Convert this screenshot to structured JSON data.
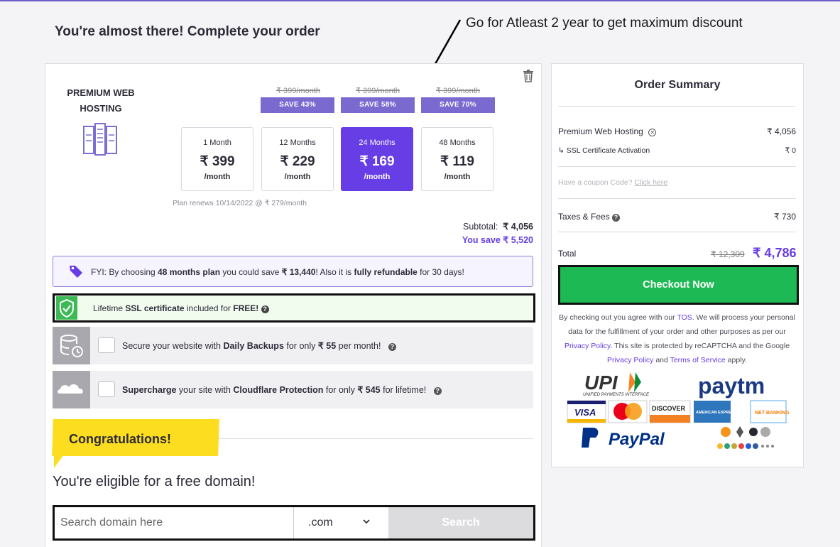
{
  "header": {
    "title": "You're almost there! Complete your order",
    "annotation": "Go for Atleast 2 year to get maximum discount"
  },
  "product": {
    "name": "PREMIUM WEB HOSTING",
    "icon": "server-icon"
  },
  "plans": [
    {
      "duration": "1 Month",
      "price": "₹ 399",
      "per": "/month",
      "old_price": "",
      "badge": "",
      "selected": false
    },
    {
      "duration": "12 Months",
      "price": "₹ 229",
      "per": "/month",
      "old_price": "₹ 399/month",
      "badge": "SAVE 43%",
      "selected": false
    },
    {
      "duration": "24 Months",
      "price": "₹ 169",
      "per": "/month",
      "old_price": "₹ 399/month",
      "badge": "SAVE 58%",
      "selected": true
    },
    {
      "duration": "48 Months",
      "price": "₹ 119",
      "per": "/month",
      "old_price": "₹ 399/month",
      "badge": "SAVE 70%",
      "selected": false
    }
  ],
  "renews": "Plan renews 10/14/2022 @ ₹ 279/month",
  "subtotal": {
    "label": "Subtotal:",
    "value": "₹ 4,056"
  },
  "you_save": "You save ₹ 5,520",
  "fyi": {
    "prefix": "FYI: By choosing ",
    "plan": "48 months plan",
    "mid": " you could save ",
    "amount": "₹ 13,440",
    "mid2": "! Also it is ",
    "refund": "fully refundable",
    "suffix": " for 30 days!"
  },
  "ssl": {
    "prefix": "Lifetime ",
    "bold": "SSL certificate",
    "mid": " included for ",
    "free": "FREE!"
  },
  "addons": {
    "backups": {
      "prefix": "Secure your website with ",
      "bold": "Daily Backups",
      "mid": " for only ",
      "price": "₹ 55",
      "suffix": " per month!"
    },
    "cloudflare": {
      "bold1": "Supercharge",
      "mid": " your site with ",
      "bold2": "Cloudflare Protection",
      "mid2": " for only ",
      "price": "₹ 545",
      "suffix": " for lifetime!"
    }
  },
  "congrats": "Congratulations!",
  "eligible": "You're eligible for a free domain!",
  "domain": {
    "placeholder": "Search domain here",
    "tld": ".com",
    "button": "Search"
  },
  "summary": {
    "title": "Order Summary",
    "hosting": {
      "label": "Premium Web Hosting",
      "value": "₹ 4,056"
    },
    "ssl": {
      "label": "↳ SSL Certificate Activation",
      "value": "₹ 0"
    },
    "coupon": {
      "text": "Have a coupon Code? ",
      "link": "Click here"
    },
    "taxes": {
      "label": "Taxes & Fees",
      "value": "₹ 730"
    },
    "total": {
      "label": "Total",
      "old": "₹ 12,309",
      "new": "₹ 4,786"
    },
    "checkout": "Checkout Now",
    "legal": {
      "p1": "By checking out you agree with our ",
      "tos": "TOS",
      "p2": ". We will process your personal data for the fulfillment of your order and other purposes as per our ",
      "privacy": "Privacy Policy",
      "p3": ". This site is protected by reCAPTCHA and the Google ",
      "privacy2": "Privacy Policy",
      "and": " and ",
      "terms": "Terms of Service",
      "p4": " apply."
    }
  },
  "payments": {
    "upi": "UPI",
    "upi_sub": "UNIFIED PAYMENTS INTERFACE",
    "paytm": "paytm",
    "visa": "VISA",
    "discover": "DISCOVER",
    "amex": "AMERICAN EXPRESS",
    "net": "NET BANKING",
    "paypal": "PayPal"
  },
  "colors": {
    "accent": "#673de6",
    "badge": "#7a6ad0",
    "checkout": "#1db954",
    "congrats": "#fddd1f"
  }
}
